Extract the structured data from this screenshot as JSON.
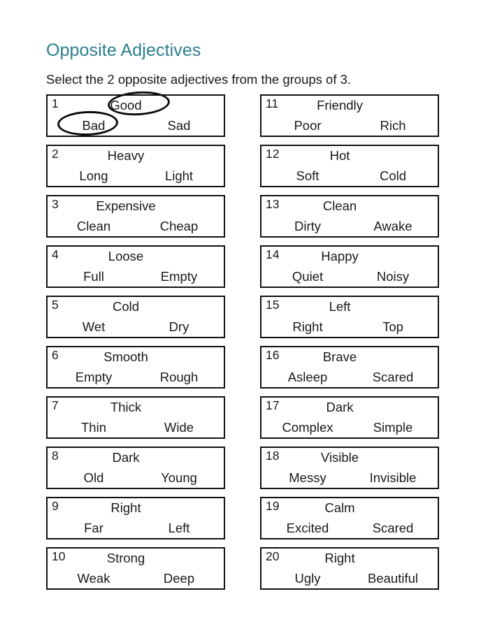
{
  "header": {
    "title": "Opposite Adjectives",
    "instructions": "Select the 2 opposite adjectives from the groups of 3.",
    "title_color": "#2b7f8e",
    "text_color": "#1a1a1a"
  },
  "columns": {
    "left": [
      {
        "number": "1",
        "top": "Good",
        "left": "Bad",
        "right": "Sad"
      },
      {
        "number": "2",
        "top": "Heavy",
        "left": "Long",
        "right": "Light"
      },
      {
        "number": "3",
        "top": "Expensive",
        "left": "Clean",
        "right": "Cheap"
      },
      {
        "number": "4",
        "top": "Loose",
        "left": "Full",
        "right": "Empty"
      },
      {
        "number": "5",
        "top": "Cold",
        "left": "Wet",
        "right": "Dry"
      },
      {
        "number": "6",
        "top": "Smooth",
        "left": "Empty",
        "right": "Rough"
      },
      {
        "number": "7",
        "top": "Thick",
        "left": "Thin",
        "right": "Wide"
      },
      {
        "number": "8",
        "top": "Dark",
        "left": "Old",
        "right": "Young"
      },
      {
        "number": "9",
        "top": "Right",
        "left": "Far",
        "right": "Left"
      },
      {
        "number": "10",
        "top": "Strong",
        "left": "Weak",
        "right": "Deep"
      }
    ],
    "right": [
      {
        "number": "11",
        "top": "Friendly",
        "left": "Poor",
        "right": "Rich"
      },
      {
        "number": "12",
        "top": "Hot",
        "left": "Soft",
        "right": "Cold"
      },
      {
        "number": "13",
        "top": "Clean",
        "left": "Dirty",
        "right": "Awake"
      },
      {
        "number": "14",
        "top": "Happy",
        "left": "Quiet",
        "right": "Noisy"
      },
      {
        "number": "15",
        "top": "Left",
        "left": "Right",
        "right": "Top"
      },
      {
        "number": "16",
        "top": "Brave",
        "left": "Asleep",
        "right": "Scared"
      },
      {
        "number": "17",
        "top": "Dark",
        "left": "Complex",
        "right": "Simple"
      },
      {
        "number": "18",
        "top": "Visible",
        "left": "Messy",
        "right": "Invisible"
      },
      {
        "number": "19",
        "top": "Calm",
        "left": "Excited",
        "right": "Scared"
      },
      {
        "number": "20",
        "top": "Right",
        "left": "Ugly",
        "right": "Beautiful"
      }
    ]
  },
  "annotations": {
    "circled": [
      "Good",
      "Bad"
    ],
    "circle_group_number": "1",
    "icon_names": [
      "circle-annotation-icon"
    ]
  }
}
